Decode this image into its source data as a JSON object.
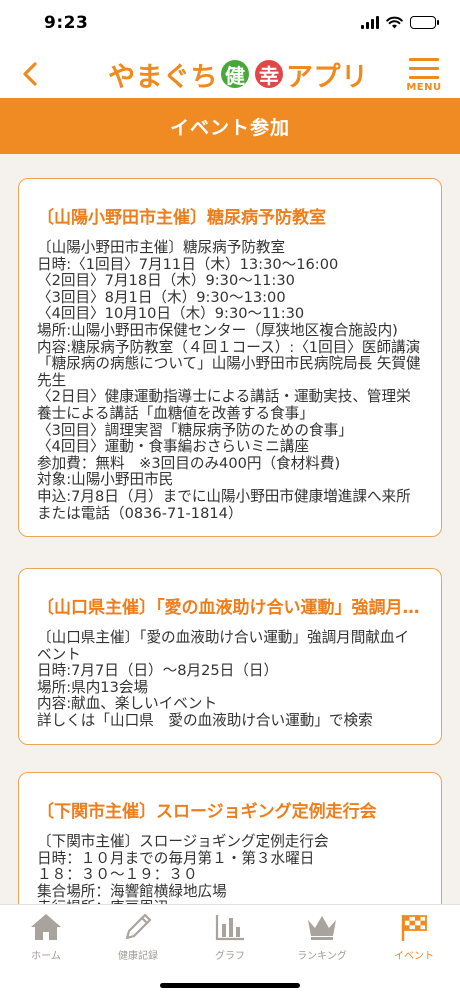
{
  "status": {
    "time": "9:23"
  },
  "header": {
    "back_icon": "chevron-left-icon",
    "logo": {
      "part1": "やまぐち",
      "badge1": "健",
      "badge2": "幸",
      "part2": "アプリ"
    },
    "menu_label": "MENU",
    "accent": "#ef8a1e"
  },
  "title_bar": {
    "title": "イベント参加",
    "color": "#f08b24"
  },
  "events": [
    {
      "title": "〔山陽小野田市主催〕糖尿病予防教室",
      "body": "〔山陽小野田市主催〕糖尿病予防教室\n日時:〈1回目〉7月11日（木）13:30〜16:00\n〈2回目〉7月18日（木）9:30〜11:30\n〈3回目〉8月1日（木）9:30〜13:00\n〈4回目〉10月10日（木）9:30〜11:30\n場所:山陽小野田市保健センター（厚狭地区複合施設内)\n内容:糖尿病予防教室（４回１コース）:〈1回目〉医師講演「糖尿病の病態について」山陽小野田市民病院局長 矢賀健先生\n〈2日目〉健康運動指導士による講話・運動実技、管理栄養士による講話「血糖値を改善する食事」\n〈3回目〉調理実習「糖尿病予防のための食事」\n〈4回目〉運動・食事編おさらいミニ講座\n参加費：無料　※3回目のみ400円（食材料費)\n対象:山陽小野田市民\n申込:7月8日（月）までに山陽小野田市健康増進課へ来所または電話（0836-71-1814）"
    },
    {
      "title": "〔山口県主催〕「愛の血液助け合い運動」強調月間献血イベント",
      "body": "〔山口県主催〕「愛の血液助け合い運動」強調月間献血イベント\n日時:7月7日（日）〜8月25日（日）\n場所:県内13会場\n内容:献血、楽しいイベント\n詳しくは「山口県　愛の血液助け合い運動」で検索"
    },
    {
      "title": "〔下関市主催〕スロージョギング定例走行会",
      "body": "〔下関市主催〕スロージョギング定例走行会\n日時：１０月までの毎月第１・第３水曜日\n１８：３０〜１９：３０\n集合場所：海響館横緑地広場\n走行場所：唐戸周辺"
    }
  ],
  "tabs": [
    {
      "label": "ホーム",
      "icon": "home-icon",
      "active": false
    },
    {
      "label": "健康記録",
      "icon": "pencil-icon",
      "active": false
    },
    {
      "label": "グラフ",
      "icon": "bar-chart-icon",
      "active": false
    },
    {
      "label": "ランキング",
      "icon": "crown-icon",
      "active": false
    },
    {
      "label": "イベント",
      "icon": "flag-icon",
      "active": true
    }
  ]
}
